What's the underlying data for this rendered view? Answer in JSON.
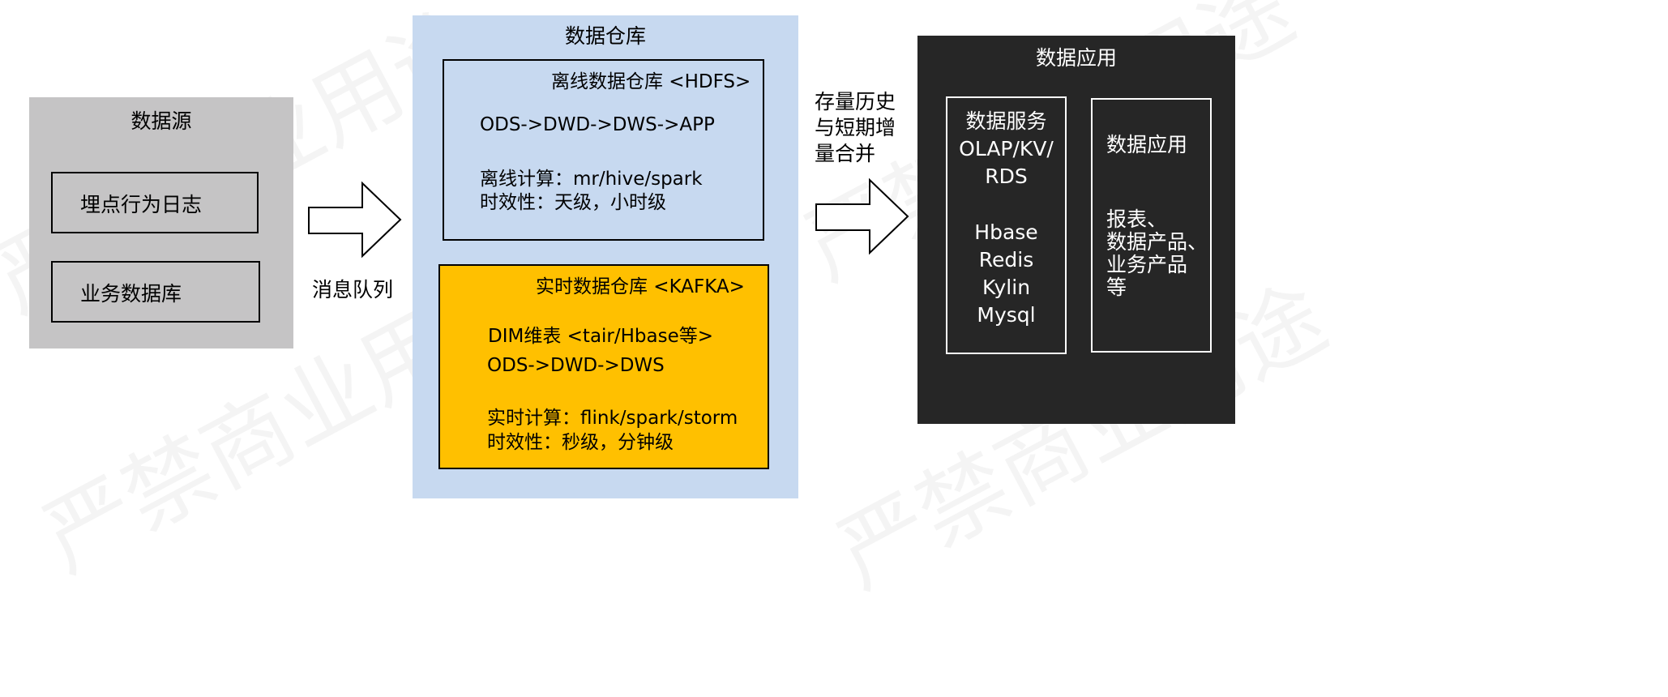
{
  "watermark": "严禁商业用途",
  "source": {
    "title": "数据源",
    "items": [
      "埋点行为日志",
      "业务数据库"
    ]
  },
  "arrow1_label": "消息队列",
  "warehouse": {
    "title": "数据仓库",
    "offline": {
      "title": "离线数据仓库 <HDFS>",
      "pipeline": "ODS->DWD->DWS->APP",
      "compute": "离线计算：mr/hive/spark",
      "latency": "时效性：天级，小时级"
    },
    "realtime": {
      "title": "实时数据仓库 <KAFKA>",
      "dim": "DIM维表 <tair/Hbase等>",
      "pipeline": "ODS->DWD->DWS",
      "compute": "实时计算：flink/spark/storm",
      "latency": "时效性：秒级，分钟级"
    }
  },
  "arrow2_label": [
    "存量历史",
    "与短期增",
    "量合并"
  ],
  "app": {
    "title": "数据应用",
    "service": {
      "title": [
        "数据服务",
        "OLAP/KV/",
        "RDS"
      ],
      "stores": [
        "Hbase",
        "Redis",
        "Kylin",
        "Mysql"
      ]
    },
    "usage": {
      "title": "数据应用",
      "items": [
        "报表、",
        "数据产品、",
        "业务产品",
        "等"
      ]
    }
  },
  "colors": {
    "source_bg": "#c5c4c5",
    "warehouse_bg": "#c7d9f0",
    "realtime_bg": "#ffc000",
    "app_bg": "#262626"
  }
}
